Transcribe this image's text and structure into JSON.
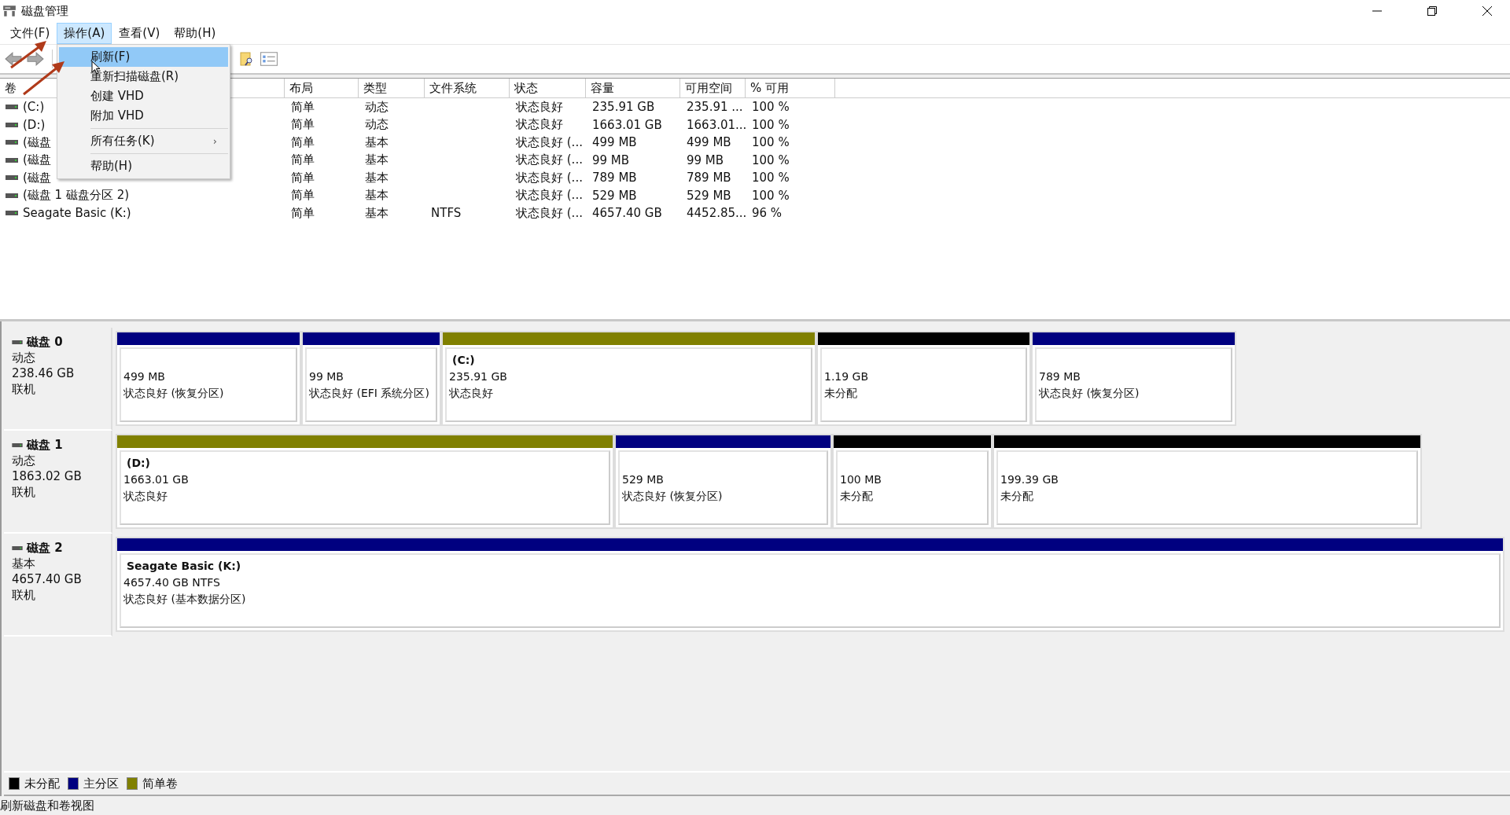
{
  "window": {
    "title": "磁盘管理"
  },
  "menu_bar": [
    {
      "label": "文件(F)",
      "selected": false
    },
    {
      "label": "操作(A)",
      "selected": true
    },
    {
      "label": "查看(V)",
      "selected": false
    },
    {
      "label": "帮助(H)",
      "selected": false
    }
  ],
  "dropdown": [
    {
      "kind": "item",
      "label": "刷新(F)",
      "selected": true
    },
    {
      "kind": "item",
      "label": "重新扫描磁盘(R)",
      "selected": false
    },
    {
      "kind": "item",
      "label": "创建 VHD",
      "selected": false
    },
    {
      "kind": "item",
      "label": "附加 VHD",
      "selected": false
    },
    {
      "kind": "separator"
    },
    {
      "kind": "submenu",
      "label": "所有任务(K)",
      "mark": "›",
      "selected": false
    },
    {
      "kind": "separator"
    },
    {
      "kind": "item",
      "label": "帮助(H)",
      "selected": false
    }
  ],
  "table": {
    "columns": [
      "卷",
      "布局",
      "类型",
      "文件系统",
      "状态",
      "容量",
      "可用空间",
      "% 可用"
    ],
    "rows": [
      [
        "(C:)",
        "简单",
        "动态",
        "",
        "状态良好",
        "235.91 GB",
        "235.91 ...",
        "100 %"
      ],
      [
        "(D:)",
        "简单",
        "动态",
        "",
        "状态良好",
        "1663.01 GB",
        "1663.01...",
        "100 %"
      ],
      [
        "(磁盘",
        "简单",
        "基本",
        "",
        "状态良好 (...",
        "499 MB",
        "499 MB",
        "100 %"
      ],
      [
        "(磁盘",
        "简单",
        "基本",
        "",
        "状态良好 (...",
        "99 MB",
        "99 MB",
        "100 %"
      ],
      [
        "(磁盘",
        "简单",
        "基本",
        "",
        "状态良好 (...",
        "789 MB",
        "789 MB",
        "100 %"
      ],
      [
        "(磁盘 1 磁盘分区 2)",
        "简单",
        "基本",
        "",
        "状态良好 (...",
        "529 MB",
        "529 MB",
        "100 %"
      ],
      [
        "Seagate Basic (K:)",
        "简单",
        "基本",
        "NTFS",
        "状态良好 (...",
        "4657.40 GB",
        "4452.85...",
        "96 %"
      ]
    ]
  },
  "disks": [
    {
      "name": "磁盘 0",
      "type": "动态",
      "size": "238.46 GB",
      "status": "联机",
      "partitions": [
        {
          "color": "#000080",
          "size": "499 MB",
          "status": "状态良好 (恢复分区)"
        },
        {
          "color": "#000080",
          "size": "99 MB",
          "status": "状态良好 (EFI 系统分区)"
        },
        {
          "color": "#808000",
          "name": "(C:)",
          "size": "235.91 GB",
          "status": "状态良好"
        },
        {
          "color": "#000000",
          "size": "1.19 GB",
          "status": "未分配"
        },
        {
          "color": "#000080",
          "size": "789 MB",
          "status": "状态良好 (恢复分区)"
        }
      ]
    },
    {
      "name": "磁盘 1",
      "type": "动态",
      "size": "1863.02 GB",
      "status": "联机",
      "partitions": [
        {
          "color": "#808000",
          "name": "(D:)",
          "size": "1663.01 GB",
          "status": "状态良好"
        },
        {
          "color": "#000080",
          "size": "529 MB",
          "status": "状态良好 (恢复分区)"
        },
        {
          "color": "#000000",
          "size": "100 MB",
          "status": "未分配"
        },
        {
          "color": "#000000",
          "size": "199.39 GB",
          "status": "未分配"
        }
      ]
    },
    {
      "name": "磁盘 2",
      "type": "基本",
      "size": "4657.40 GB",
      "status": "联机",
      "partitions": [
        {
          "color": "#000080",
          "name": "Seagate Basic  (K:)",
          "size": "4657.40 GB NTFS",
          "status": "状态良好 (基本数据分区)"
        }
      ]
    }
  ],
  "legend": [
    {
      "color": "#000000",
      "label": "未分配"
    },
    {
      "color": "#000080",
      "label": "主分区"
    },
    {
      "color": "#808000",
      "label": "简单卷"
    }
  ],
  "status_bar": "刷新磁盘和卷视图"
}
